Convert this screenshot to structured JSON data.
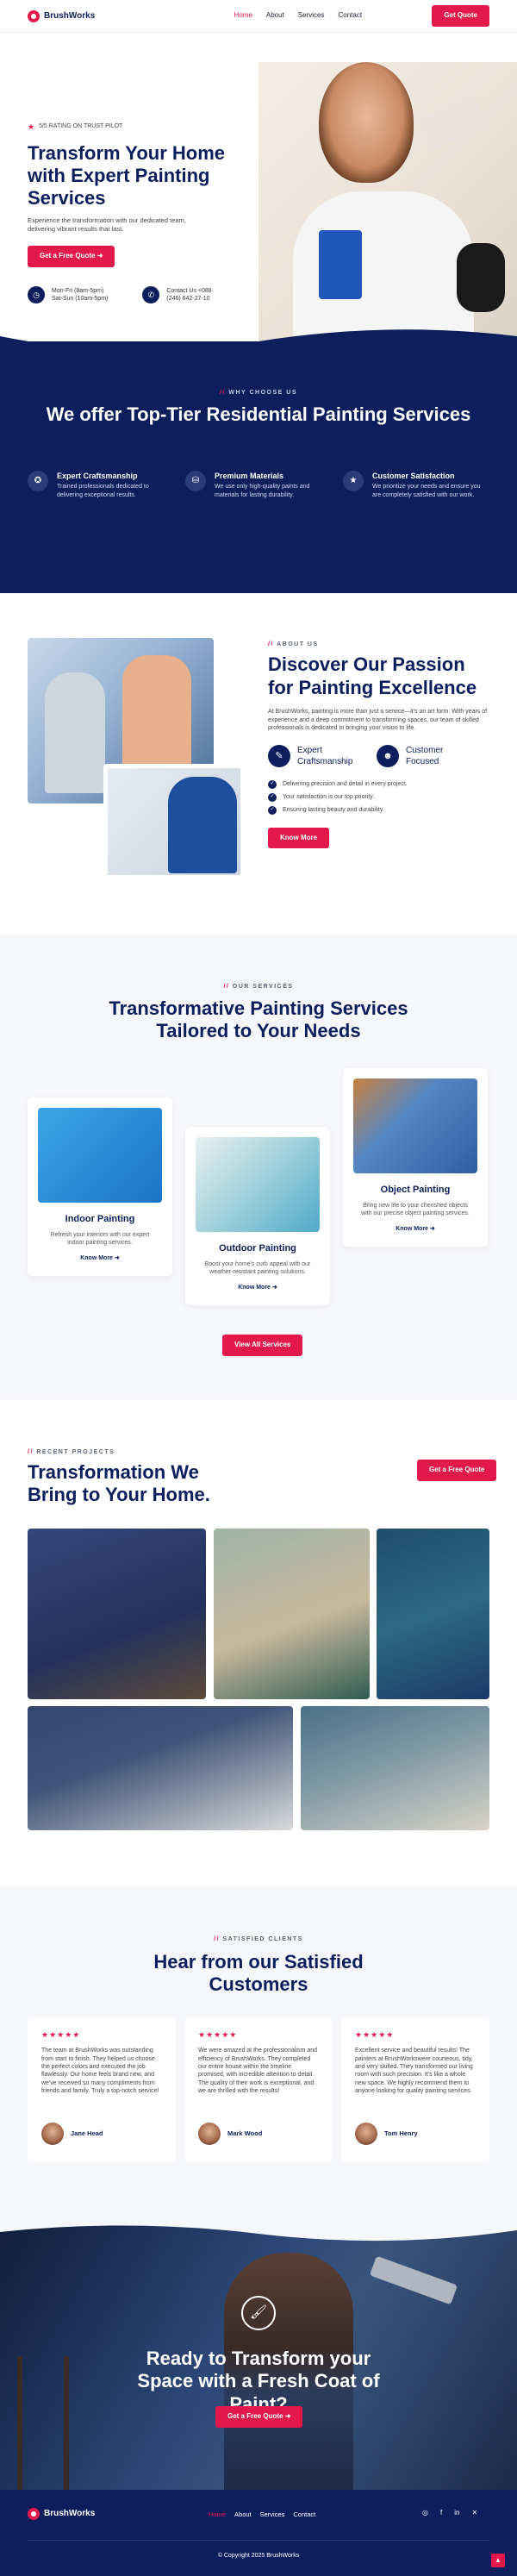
{
  "brand": {
    "name": "BrushWorks"
  },
  "nav": {
    "items": [
      "Home",
      "About",
      "Services",
      "Contact"
    ],
    "cta": "Get Quote"
  },
  "hero": {
    "trust": "5/5 RATING ON TRUST PILOT",
    "title": "Transform Your Home with Expert Painting Services",
    "desc": "Experience the transformation with our dedicated team, delivering vibrant results that last.",
    "cta": "Get a Free Quote",
    "contacts": [
      {
        "icon": "clock-icon",
        "line1": "Mon-Fri (8am-5pm)",
        "line2": "Sat-Sun (10am-5pm)"
      },
      {
        "icon": "phone-icon",
        "line1": "Contact Us +088",
        "line2": "(246) 642-27-10"
      }
    ]
  },
  "why": {
    "tag": "WHY CHOOSE US",
    "title": "We offer Top-Tier Residential Painting Services",
    "features": [
      {
        "icon": "badge-icon",
        "title": "Expert Craftsmanship",
        "desc": "Trained professionals dedicated to delivering exceptional results."
      },
      {
        "icon": "paint-bucket-icon",
        "title": "Premium Materials",
        "desc": "We use only high-quality paints and materials for lasting durability."
      },
      {
        "icon": "star-icon",
        "title": "Customer Satisfaction",
        "desc": "We prioritize your needs and ensure you are completely satisfied with our work."
      }
    ]
  },
  "about": {
    "tag": "ABOUT US",
    "title": "Discover Our Passion for Painting Excellence",
    "desc": "At BrushWorks, painting is more than just a service—it's an art form. With years of experience and a deep commitment to transforming spaces, our team of skilled professionals is dedicated to bringing your vision to life.",
    "features": [
      {
        "label": "Expert Craftsmanship"
      },
      {
        "label": "Customer Focused"
      }
    ],
    "checks": [
      "Delivering precision and detail in every project.",
      "Your satisfaction is our top priority.",
      "Ensuring lasting beauty and durability."
    ],
    "cta": "Know More"
  },
  "services": {
    "tag": "OUR SERVICES",
    "title": "Transformative Painting Services Tailored to Your Needs",
    "items": [
      {
        "title": "Indoor Painting",
        "desc": "Refresh your interiors with our expert indoor painting services.",
        "cta": "Know More"
      },
      {
        "title": "Outdoor Painting",
        "desc": "Boost your home's curb appeal with our weather-resistant painting solutions.",
        "cta": "Know More"
      },
      {
        "title": "Object Painting",
        "desc": "Bring new life to your cherished objects with our precise object painting services.",
        "cta": "Know More"
      }
    ],
    "cta": "View All Services"
  },
  "projects": {
    "tag": "RECENT PROJECTS",
    "title": "Transformation We Bring to Your Home.",
    "cta": "Get a Free Quote"
  },
  "testimonials": {
    "tag": "SATISFIED CLIENTS",
    "title": "Hear from our Satisfied Customers",
    "items": [
      {
        "stars": "★★★★★",
        "text": "The team at BrushWorks was outstanding from start to finish. They helped us choose the perfect colors and executed the job flawlessly. Our home feels brand new, and we've received so many compliments from friends and family. Truly a top-notch service!",
        "name": "Jane Head"
      },
      {
        "stars": "★★★★★",
        "text": "We were amazed at the professionalism and efficiency of BrushWorks. They completed our entire house within the timeline promised, with incredible attention to detail. The quality of their work is exceptional, and we are thrilled with the results!",
        "name": "Mark Wood"
      },
      {
        "stars": "★★★★★",
        "text": "Excellent service and beautiful results! The painters at BrushWorkswere courteous, tidy, and very skilled. They transformed our living room with such precision. It's like a whole new space. We highly recommend them to anyone looking for quality painting services.",
        "name": "Tom Henry"
      }
    ]
  },
  "cta": {
    "title": "Ready to Transform your Space with a Fresh Coat of Paint?",
    "button": "Get a Free Quote"
  },
  "footer": {
    "nav": [
      "Home",
      "About",
      "Services",
      "Contact"
    ],
    "copyright": "© Copyright 2025 BrushWorks"
  },
  "colors": {
    "accent": "#e3194b",
    "navy": "#0c1f5c"
  }
}
